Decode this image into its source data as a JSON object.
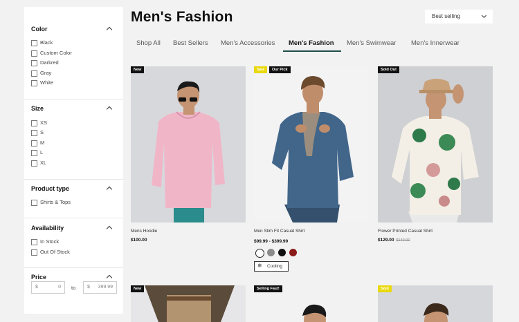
{
  "page": {
    "title": "Men's Fashion"
  },
  "sort": {
    "label": "Best selling",
    "icon": "chevron-down-icon"
  },
  "tabs": [
    {
      "label": "Shop All",
      "active": false
    },
    {
      "label": "Best Sellers",
      "active": false
    },
    {
      "label": "Men's Accessories",
      "active": false
    },
    {
      "label": "Men's Fashion",
      "active": true
    },
    {
      "label": "Men's Swimwear",
      "active": false
    },
    {
      "label": "Men's Innerwear",
      "active": false
    }
  ],
  "filters": {
    "color": {
      "title": "Color",
      "options": [
        "Black",
        "Custom Color",
        "Darkred",
        "Gray",
        "White"
      ]
    },
    "size": {
      "title": "Size",
      "options": [
        "XS",
        "S",
        "M",
        "L",
        "XL"
      ]
    },
    "product_type": {
      "title": "Product type",
      "options": [
        "Shirts & Tops"
      ]
    },
    "availability": {
      "title": "Availability",
      "options": [
        "In Stock",
        "Out Of Stock"
      ]
    },
    "price": {
      "title": "Price",
      "currency": "$",
      "min": "0",
      "to_label": "to",
      "max": "399.99"
    }
  },
  "products": [
    {
      "name": "Mens Hoodie",
      "price": "$100.00",
      "old_price": "",
      "badges": [
        "New"
      ]
    },
    {
      "name": "Men Slim Fit Casual Shirt",
      "price": "$99.99 - $399.99",
      "old_price": "",
      "badges": [
        "Sale",
        "Our Pick"
      ],
      "swatches": [
        "#ffffff",
        "#8a8a8a",
        "#111111",
        "#8b1a1a"
      ],
      "tag": "Cooling"
    },
    {
      "name": "Flower Printed Casual Shirt",
      "price": "$129.00",
      "old_price": "$149.00",
      "badges": [
        "Sold Out"
      ]
    }
  ],
  "row2_badges": [
    "New",
    "Selling Fast!",
    "Sold"
  ],
  "colors": {
    "accent": "#1f4d48",
    "badge_dark": "#111111",
    "badge_yellow": "#e9d90a"
  }
}
